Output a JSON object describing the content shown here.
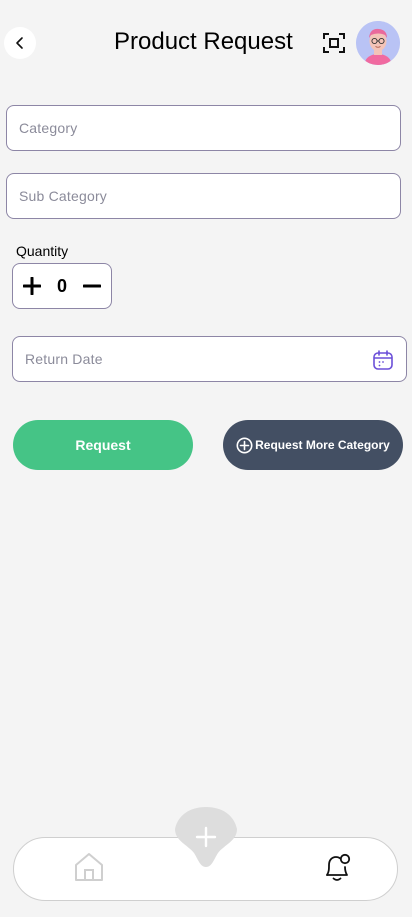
{
  "header": {
    "title": "Product Request",
    "back_icon": "chevron-left-icon",
    "scan_icon": "scan-frame-icon",
    "avatar_icon": "user-avatar"
  },
  "form": {
    "category": {
      "placeholder": "Category",
      "value": ""
    },
    "sub_category": {
      "placeholder": "Sub Category",
      "value": ""
    },
    "quantity": {
      "label": "Quantity",
      "value": "0"
    },
    "return_date": {
      "placeholder": "Return Date",
      "value": "",
      "icon": "calendar-icon"
    }
  },
  "actions": {
    "request_label": "Request",
    "request_more_label": "Request More Category"
  },
  "bottom_nav": {
    "items": [
      "home-icon",
      "plus-icon",
      "bell-icon"
    ]
  },
  "colors": {
    "primary_green": "#45c486",
    "dark_slate": "#434f63",
    "accent_purple": "#6b4fd8",
    "background": "#f4f4f4"
  }
}
